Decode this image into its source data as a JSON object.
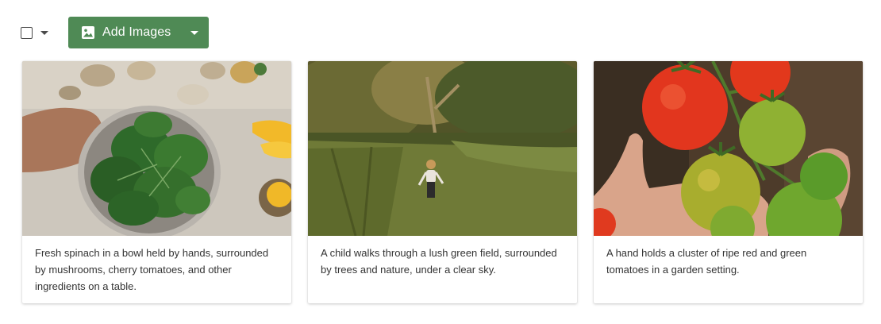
{
  "toolbar": {
    "select_all_icon": "checkbox-unchecked",
    "add_button": {
      "label": "Add Images",
      "icon": "image-icon",
      "color": "#4f8a55"
    }
  },
  "cards": [
    {
      "image": "spinach-bowl",
      "caption": "Fresh spinach in a bowl held by hands, surrounded by mushrooms, cherry tomatoes, and other ingredients on a table."
    },
    {
      "image": "child-in-field",
      "caption": "A child walks through a lush green field, surrounded by trees and nature, under a clear sky."
    },
    {
      "image": "tomato-cluster",
      "caption": "A hand holds a cluster of ripe red and green tomatoes in a garden setting."
    }
  ]
}
